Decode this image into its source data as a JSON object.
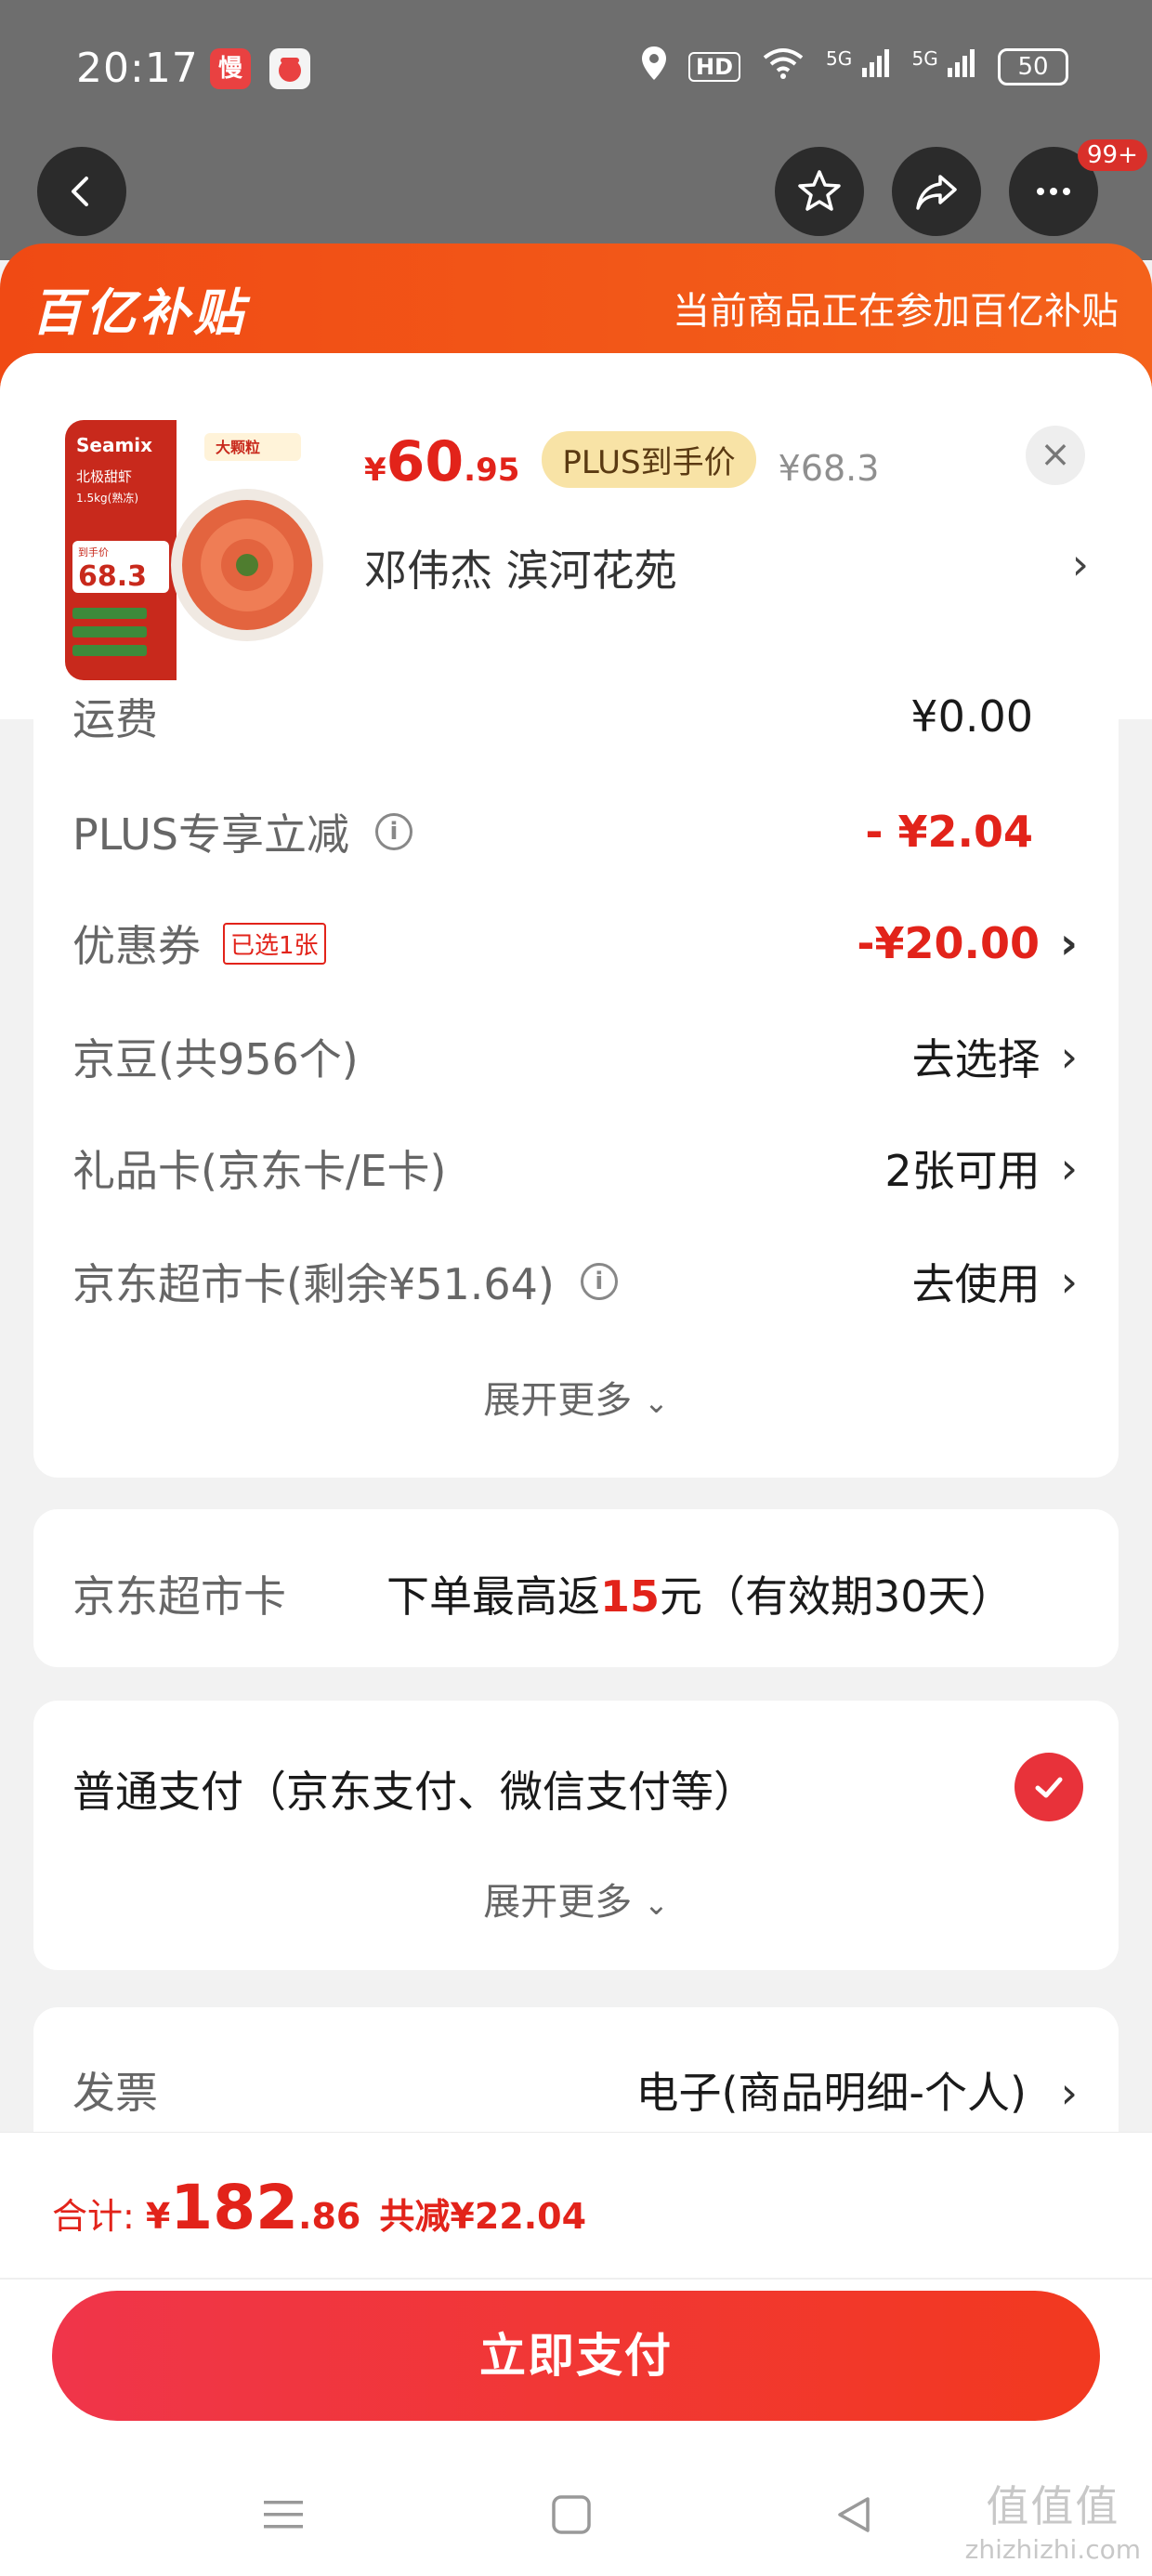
{
  "status_bar": {
    "time": "20:17",
    "badge_a": "慢",
    "badge_b": "",
    "network_label_1": "5G",
    "network_label_2": "5G",
    "hd_label": "HD",
    "battery": "50"
  },
  "nav": {
    "message_badge": "99+"
  },
  "promo": {
    "logo": "百亿补贴",
    "text": "当前商品正在参加百亿补贴"
  },
  "product": {
    "price_yen": "¥",
    "price_int": "60",
    "price_dec": ".95",
    "plus_tag": "PLUS到手价",
    "price_original": "¥68.3",
    "address": "邓伟杰  滨河花苑",
    "thumb": {
      "brand": "Seamix",
      "title": "北极甜虾",
      "spec": "1.5kg(熟冻)",
      "tag": "大颗粒",
      "price_label": "到手价",
      "price": "68.3"
    }
  },
  "price_detail": {
    "shipping_label": "运费",
    "shipping_value": "¥0.00",
    "plus_label": "PLUS专享立减",
    "plus_value": "- ¥2.04",
    "coupon_label": "优惠券",
    "coupon_chip": "已选1张",
    "coupon_value": "-¥20.00",
    "jdbean_label": "京豆(共956个)",
    "jdbean_value": "去选择",
    "giftcard_label": "礼品卡(京东卡/E卡)",
    "giftcard_value": "2张可用",
    "supermarket_label": "京东超市卡(剩余¥51.64)",
    "supermarket_value": "去使用",
    "expand_label": "展开更多"
  },
  "supermarket_card": {
    "label": "京东超市卡",
    "rebate_prefix": "下单最高返",
    "rebate_amount": "15",
    "rebate_suffix": "元（有效期30天）"
  },
  "payment": {
    "label": "普通支付（京东支付、微信支付等）",
    "expand_label": "展开更多"
  },
  "invoice": {
    "label": "发票",
    "value": "电子(商品明细-个人)"
  },
  "footer": {
    "total_label": "合计:",
    "total_yen": "¥",
    "total_int": "182",
    "total_dec": ".86",
    "saving": "共减¥22.04",
    "pay_button": "立即支付"
  },
  "watermark": {
    "big": "值值值",
    "small": "zhizhizhi.com"
  },
  "colors": {
    "accent_red": "#e2231a",
    "promo_orange": "#f04a14",
    "plus_gold": "#f8e3a6"
  }
}
